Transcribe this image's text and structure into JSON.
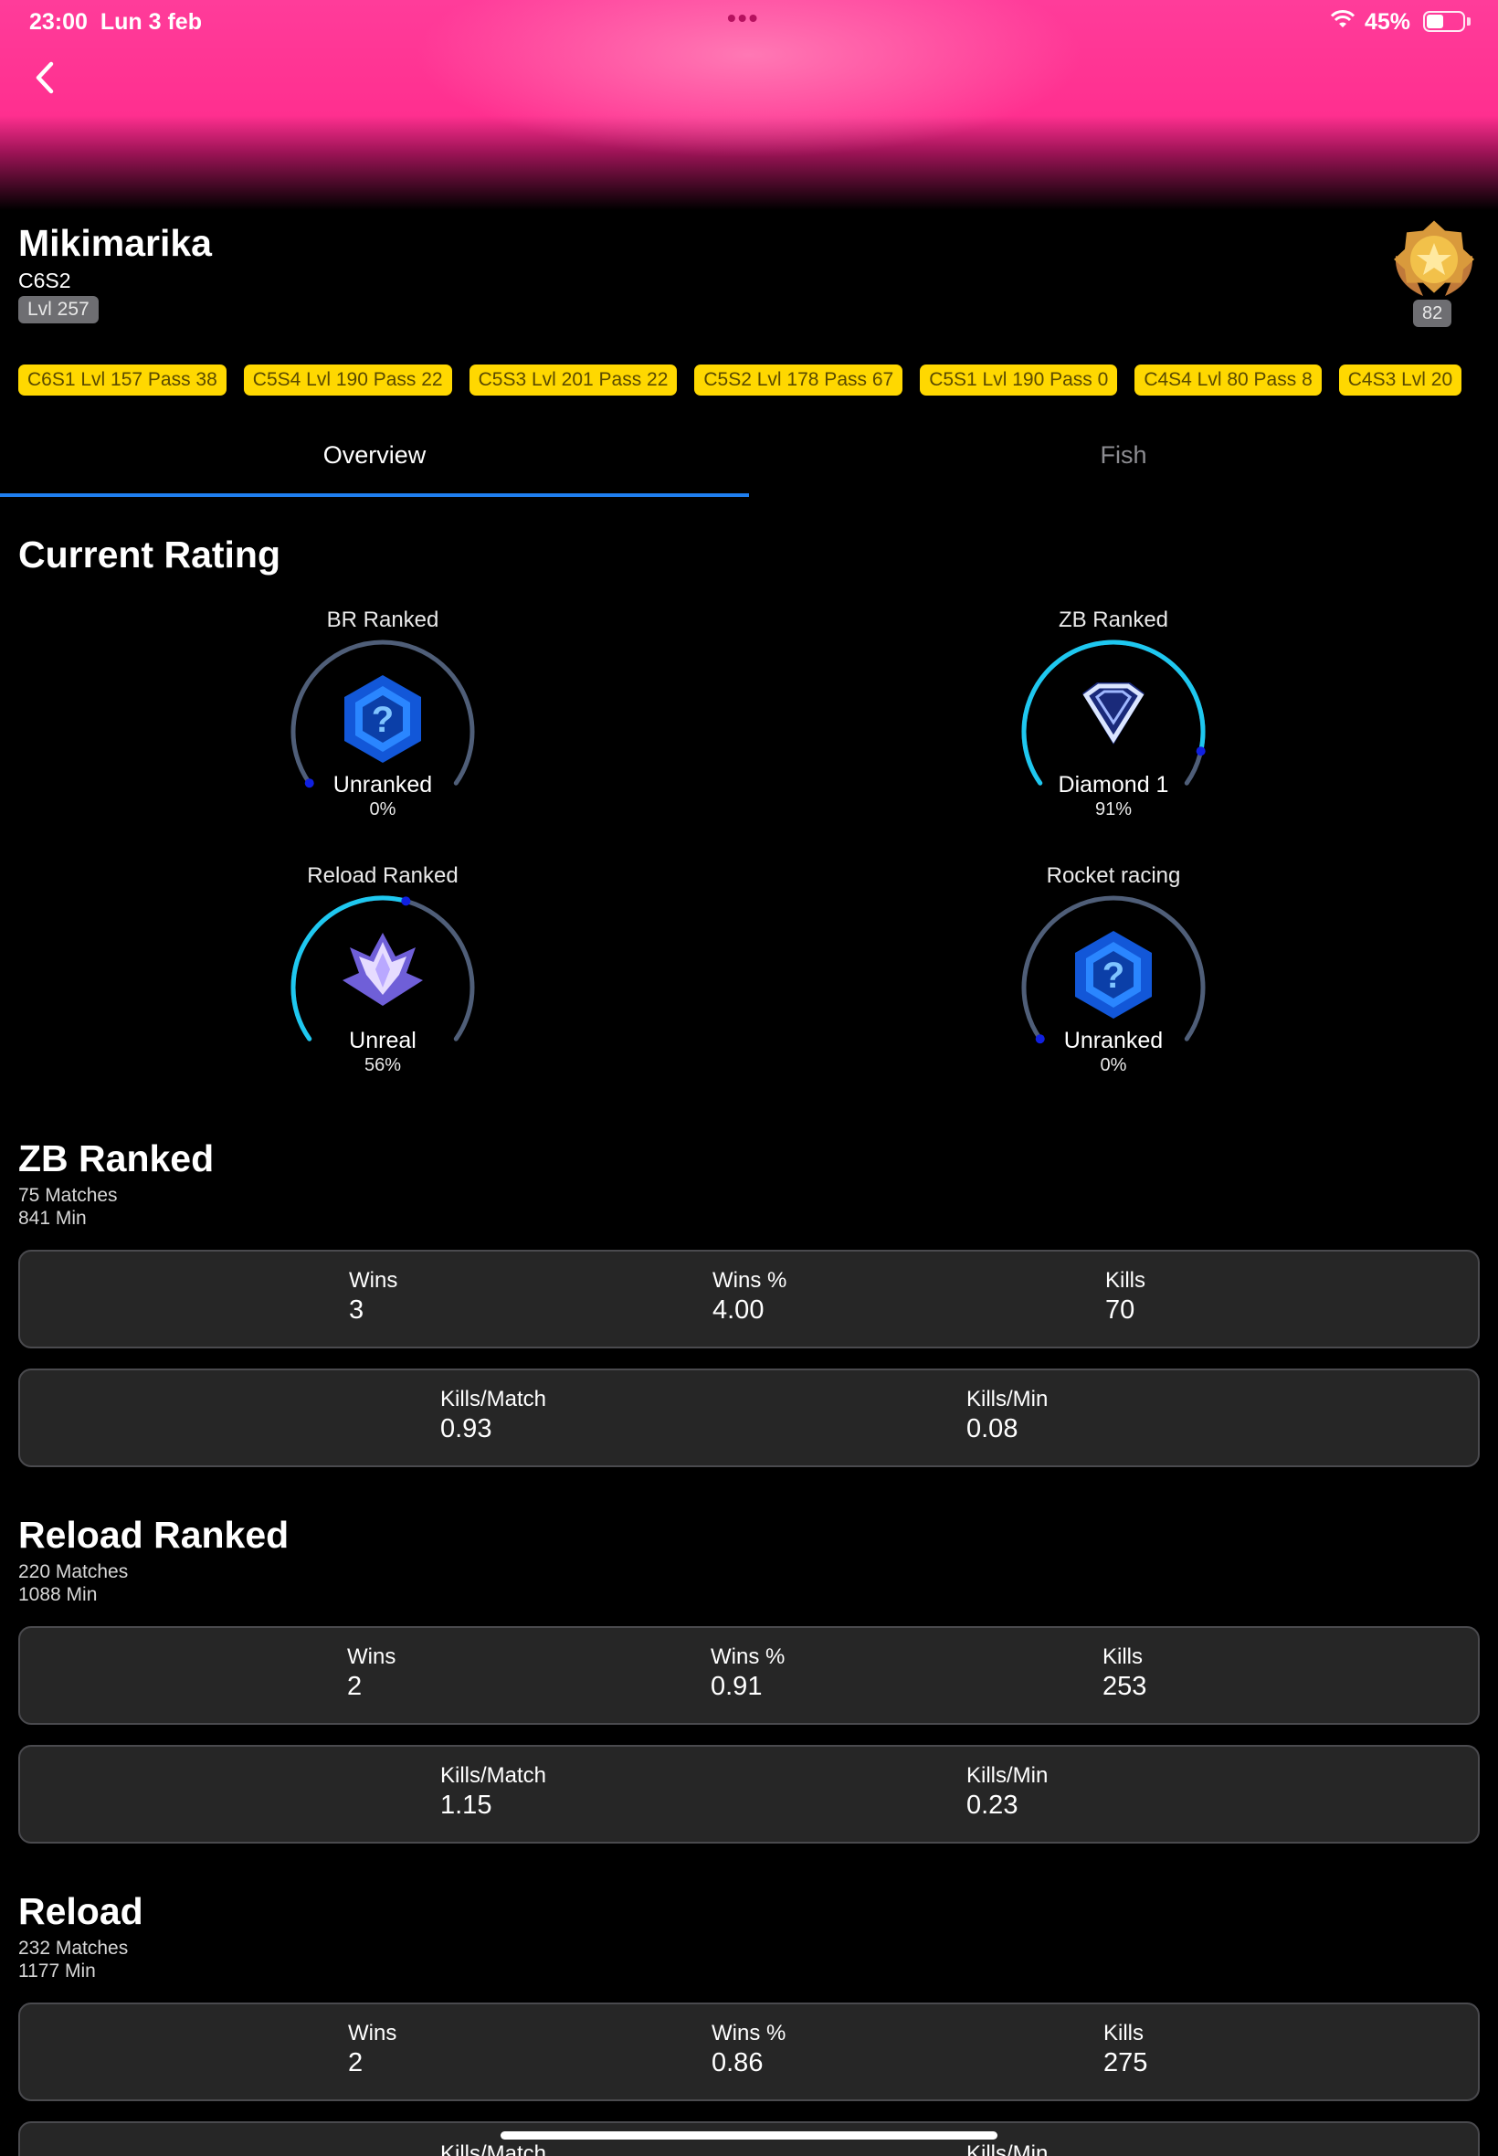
{
  "status_bar": {
    "time": "23:00",
    "date": "Lun 3 feb",
    "battery": "45%"
  },
  "profile": {
    "name": "Mikimarika",
    "season": "C6S2",
    "level": "Lvl 257",
    "medal_count": "82"
  },
  "passes": [
    "C6S1 Lvl 157 Pass 38",
    "C5S4 Lvl 190 Pass 22",
    "C5S3 Lvl 201 Pass 22",
    "C5S2 Lvl 178 Pass 67",
    "C5S1 Lvl 190 Pass 0",
    "C4S4 Lvl 80 Pass 8",
    "C4S3 Lvl 20"
  ],
  "tabs": {
    "overview": "Overview",
    "fish": "Fish"
  },
  "current_rating": {
    "title": "Current Rating",
    "gauges": [
      {
        "title": "BR Ranked",
        "rank": "Unranked",
        "percent": "0%",
        "progress": 0.0,
        "icon": "unranked-icon"
      },
      {
        "title": "ZB Ranked",
        "rank": "Diamond 1",
        "percent": "91%",
        "progress": 0.91,
        "icon": "diamond-icon"
      },
      {
        "title": "Reload Ranked",
        "rank": "Unreal",
        "percent": "56%",
        "progress": 0.56,
        "icon": "unreal-crown-icon"
      },
      {
        "title": "Rocket racing",
        "rank": "Unranked",
        "percent": "0%",
        "progress": 0.0,
        "icon": "unranked-icon"
      }
    ]
  },
  "sections": [
    {
      "title": "ZB Ranked",
      "matches": "75 Matches",
      "minutes": "841 Min",
      "row1": [
        {
          "label": "Wins",
          "value": "3"
        },
        {
          "label": "Wins %",
          "value": "4.00"
        },
        {
          "label": "Kills",
          "value": "70"
        }
      ],
      "row2": [
        {
          "label": "Kills/Match",
          "value": "0.93"
        },
        {
          "label": "Kills/Min",
          "value": "0.08"
        }
      ]
    },
    {
      "title": "Reload Ranked",
      "matches": "220 Matches",
      "minutes": "1088 Min",
      "row1": [
        {
          "label": "Wins",
          "value": "2"
        },
        {
          "label": "Wins %",
          "value": "0.91"
        },
        {
          "label": "Kills",
          "value": "253"
        }
      ],
      "row2": [
        {
          "label": "Kills/Match",
          "value": "1.15"
        },
        {
          "label": "Kills/Min",
          "value": "0.23"
        }
      ]
    },
    {
      "title": "Reload",
      "matches": "232 Matches",
      "minutes": "1177 Min",
      "row1": [
        {
          "label": "Wins",
          "value": "2"
        },
        {
          "label": "Wins %",
          "value": "0.86"
        },
        {
          "label": "Kills",
          "value": "275"
        }
      ],
      "row2": [
        {
          "label": "Kills/Match",
          "value": ""
        },
        {
          "label": "Kills/Min",
          "value": ""
        }
      ]
    }
  ],
  "colors": {
    "accent": "#1f7ff0",
    "gauge_progress": "#1ec8f0",
    "pass_chip": "#ffd800",
    "header_pink": "#ff3c9a"
  }
}
